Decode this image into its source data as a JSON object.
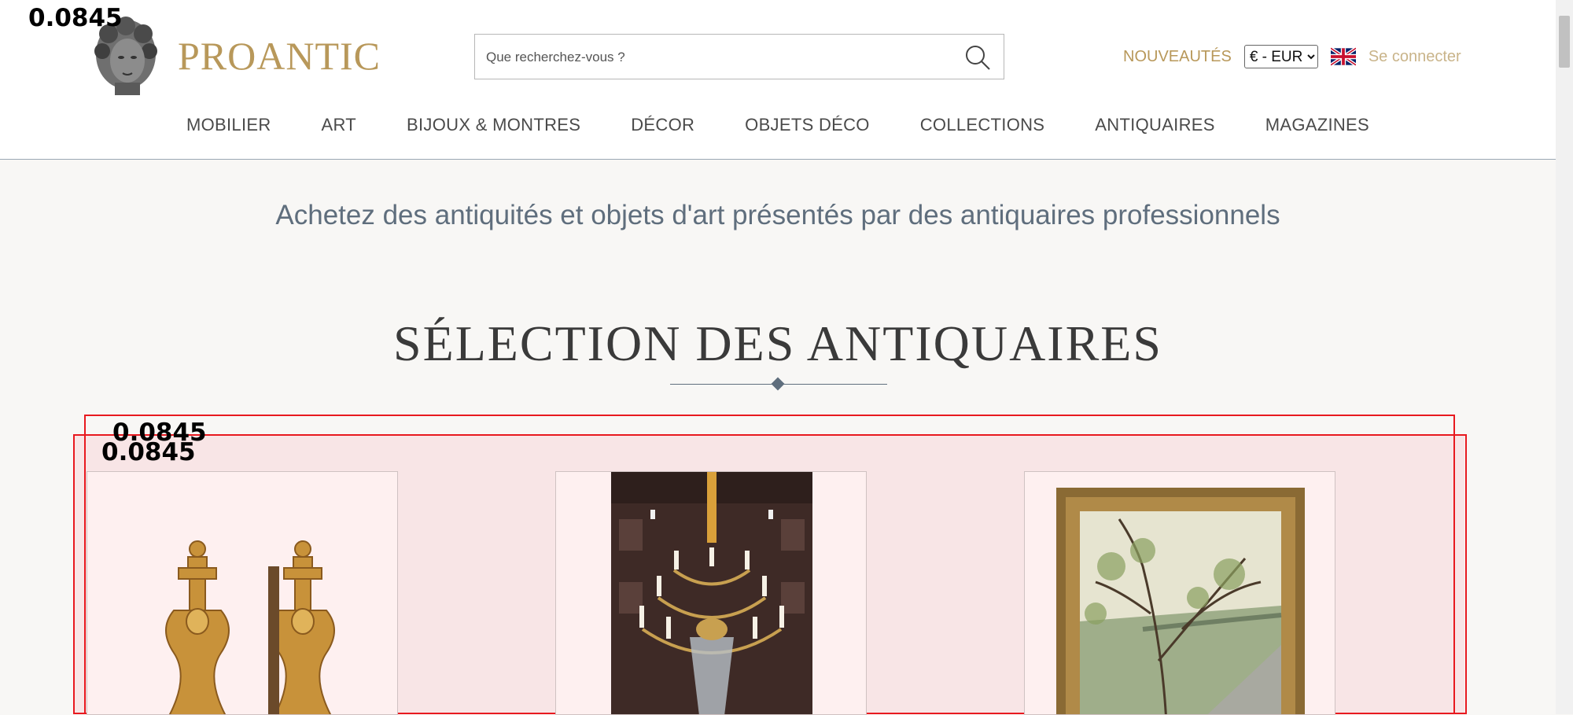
{
  "site": {
    "brand": "PROANTIC"
  },
  "search": {
    "placeholder": "Que recherchez-vous ?"
  },
  "header": {
    "nouveautes": "NOUVEAUTÉS",
    "currency": "€ - EUR",
    "login": "Se connecter"
  },
  "nav": [
    "MOBILIER",
    "ART",
    "BIJOUX & MONTRES",
    "DÉCOR",
    "OBJETS DÉCO",
    "COLLECTIONS",
    "ANTIQUAIRES",
    "MAGAZINES"
  ],
  "tagline": "Achetez des antiquités et objets d'art présentés par des antiquaires professionnels",
  "section": {
    "title": "SÉLECTION DES ANTIQUAIRES"
  },
  "annotations": [
    "0.0845",
    "0.0845",
    "0.0845"
  ],
  "products": [
    {
      "icon": "andirons-image"
    },
    {
      "icon": "chandelier-image"
    },
    {
      "icon": "framed-painting-image"
    }
  ],
  "colors": {
    "gold": "#b8985a",
    "slate": "#5f6e7d",
    "highlight": "#e8191f"
  }
}
